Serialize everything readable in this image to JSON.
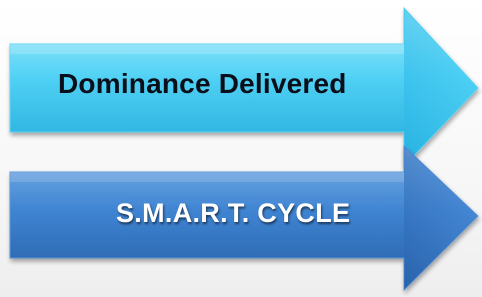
{
  "diagram": {
    "arrows": [
      {
        "label": "Dominance Delivered",
        "fill_light": "#8ee8fb",
        "fill_mid": "#39c6ef",
        "fill_dark": "#1a9fd0",
        "text_color": "#0a0f1a"
      },
      {
        "label": "S.M.A.R.T. CYCLE",
        "fill_light": "#6aa6e0",
        "fill_mid": "#3b7fcf",
        "fill_dark": "#24599e",
        "text_color": "#ffffff"
      }
    ]
  }
}
